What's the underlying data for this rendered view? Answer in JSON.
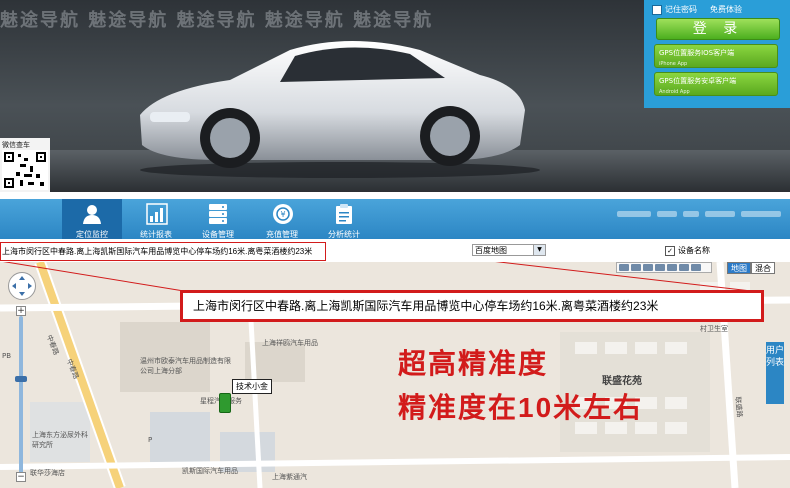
{
  "banner": {
    "brand_strip": "魅途导航  魅途导航  魅途导航  魅途导航  魅途导航",
    "qr_label": "微信查车"
  },
  "login": {
    "remember_pw": "记住密码",
    "trial": "免费体验",
    "login_button": "登 录",
    "ios_client": "GPS位置服务IOS客户端",
    "ios_sub": "iPhone App",
    "android_client": "GPS位置服务安卓客户端",
    "android_sub": "Android App"
  },
  "nav": {
    "items": [
      {
        "label": "定位监控",
        "icon": "user-icon",
        "active": true
      },
      {
        "label": "统计报表",
        "icon": "bar-chart-icon",
        "active": false
      },
      {
        "label": "设备管理",
        "icon": "server-icon",
        "active": false
      },
      {
        "label": "充值管理",
        "icon": "coins-icon",
        "active": false
      },
      {
        "label": "分析统计",
        "icon": "clipboard-icon",
        "active": false
      }
    ]
  },
  "toolbar": {
    "address_small": "上海市闵行区中春路.离上海凯斯国际汽车用品博览中心停车场约16米.离粤菜酒楼约23米",
    "map_select": "百度地图",
    "device_name_checkbox": "设备名称",
    "device_name_checked": true
  },
  "map": {
    "type_map": "地图",
    "type_mixed": "混合",
    "user_list": "用户列表",
    "tech_label": "技术小金",
    "address_big": "上海市闵行区中春路.离上海凯斯国际汽车用品博览中心停车场约16米.离粤菜酒楼约23米",
    "headline_1": "超高精准度",
    "headline_2": "精准度在10米左右",
    "poi_lianhe": "联盛花苑",
    "labels": [
      {
        "text": "中春路"
      },
      {
        "text": "中春路"
      },
      {
        "text": "上海祥鸥汽车用品"
      },
      {
        "text": "温州市欧泰汽车用品制造有限公司上海分部"
      },
      {
        "text": "星程汽车服务"
      },
      {
        "text": "上海东方泌尿外科研究所"
      },
      {
        "text": "联华莎海店"
      },
      {
        "text": "凯斯国际汽车用品"
      },
      {
        "text": "上海紫通汽"
      },
      {
        "text": "村卫生室"
      },
      {
        "text": "联盛路"
      },
      {
        "text": "PB"
      },
      {
        "text": "P"
      }
    ]
  }
}
